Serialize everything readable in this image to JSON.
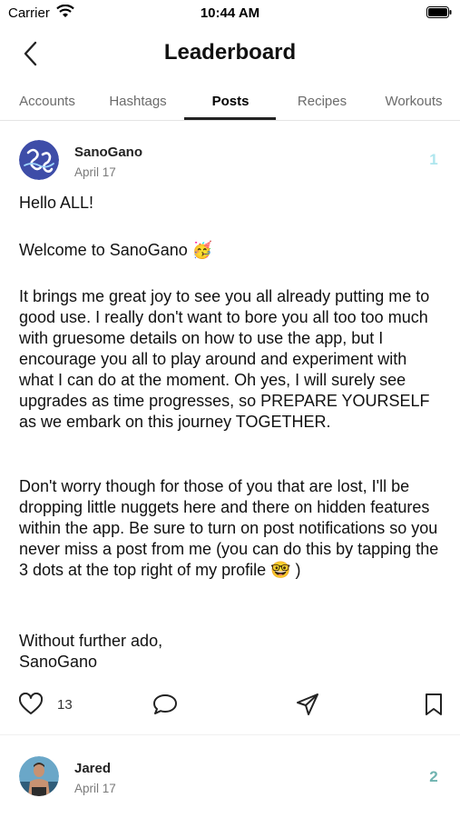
{
  "status_bar": {
    "carrier": "Carrier",
    "time": "10:44 AM"
  },
  "header": {
    "title": "Leaderboard"
  },
  "tabs": [
    {
      "label": "Accounts"
    },
    {
      "label": "Hashtags"
    },
    {
      "label": "Posts",
      "active": true
    },
    {
      "label": "Recipes"
    },
    {
      "label": "Workouts"
    }
  ],
  "post1": {
    "author": "SanoGano",
    "date": "April 17",
    "rank": "1",
    "paragraphs": {
      "p1": "Hello ALL!",
      "p2": "Welcome to SanoGano 🥳",
      "p3": "It brings me great joy to see you all already putting me to good use. I really don't want to bore you all too too much with gruesome details on how to use the app, but I encourage you all to play around and experiment with what I can do at the moment. Oh yes, I will surely see upgrades as time progresses, so PREPARE YOURSELF as we embark on this journey TOGETHER.",
      "p4": "Don't worry though for those of you that are lost, I'll be dropping little nuggets here and there on hidden features within the app. Be sure to turn on post notifications so you never miss a post from me (you can do this by tapping the 3 dots at the top right of my profile 🤓 )",
      "p5": "Without further ado,",
      "p6": "SanoGano"
    },
    "likes": "13"
  },
  "post2": {
    "author": "Jared",
    "date": "April 17",
    "rank": "2"
  },
  "colors": {
    "rank1": "#aee6ee",
    "rank2": "#6fb3b0",
    "tab_underline": "#222222"
  }
}
